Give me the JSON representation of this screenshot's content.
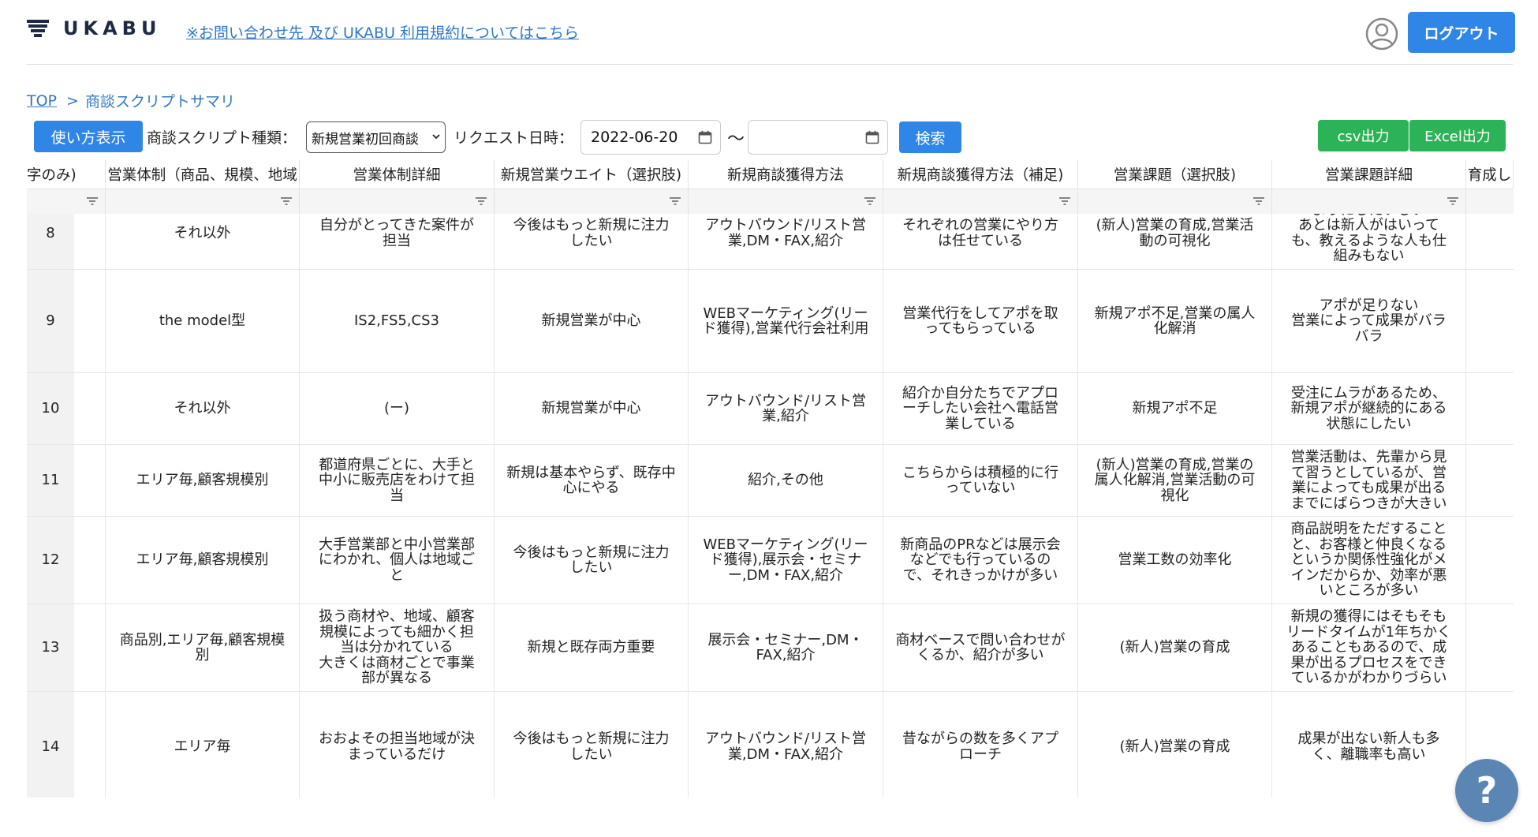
{
  "header": {
    "logo_text": "UKABU",
    "link_text": "※お問い合わせ先 及び UKABU 利用規約についてはこちら",
    "logout_label": "ログアウト"
  },
  "breadcrumb": {
    "top": "TOP",
    "separator": ">",
    "current": "商談スクリプトサマリ"
  },
  "toolbar": {
    "usage_button": "使い方表示",
    "script_type_label": "商談スクリプト種類：",
    "script_type_value": "新規営業初回商談",
    "request_date_label": "リクエスト日時：",
    "date_from": "2022-06-20",
    "date_to": "",
    "tilde": "〜",
    "search_button": "検索",
    "csv_button": "csv出力",
    "excel_button": "Excel出力"
  },
  "columns": [
    "字のみ)",
    "営業体制（商品、規模、地域",
    "営業体制詳細",
    "新規営業ウエイト（選択肢)",
    "新規商談獲得方法",
    "新規商談獲得方法（補足)",
    "営業課題（選択肢)",
    "営業課題詳細",
    "育成し"
  ],
  "rows": [
    {
      "id": "8",
      "c1": [
        "それ以外"
      ],
      "c2": [
        "自分がとってきた案件が",
        "担当"
      ],
      "c3": [
        "今後はもっと新規に注力",
        "したい"
      ],
      "c4": [
        "アウトバウンド/リスト営",
        "業,DM・FAX,紹介"
      ],
      "c5": [
        "それぞれの営業にやり方",
        "は任せている"
      ],
      "c6": [
        "(新人)営業の育成,営業活",
        "動の可視化"
      ],
      "c7": [
        "ようにしたいしい",
        "あとは新人がはいって",
        "も、教えるような人も仕",
        "組みもない"
      ]
    },
    {
      "id": "9",
      "c1": [
        "the model型"
      ],
      "c2": [
        "IS2,FS5,CS3"
      ],
      "c3": [
        "新規営業が中心"
      ],
      "c4": [
        "WEBマーケティング(リー",
        "ド獲得),営業代行会社利用"
      ],
      "c5": [
        "営業代行をしてアポを取",
        "ってもらっている"
      ],
      "c6": [
        "新規アポ不足,営業の属人",
        "化解消"
      ],
      "c7": [
        "アポが足りない",
        "営業によって成果がバラ",
        "バラ"
      ]
    },
    {
      "id": "10",
      "c1": [
        "それ以外"
      ],
      "c2": [
        "(ー)"
      ],
      "c3": [
        "新規営業が中心"
      ],
      "c4": [
        "アウトバウンド/リスト営",
        "業,紹介"
      ],
      "c5": [
        "紹介か自分たちでアプロ",
        "ーチしたい会社へ電話営",
        "業している"
      ],
      "c6": [
        "新規アポ不足"
      ],
      "c7": [
        "受注にムラがあるため、",
        "新規アポが継続的にある",
        "状態にしたい"
      ]
    },
    {
      "id": "11",
      "c1": [
        "エリア毎,顧客規模別"
      ],
      "c2": [
        "都道府県ごとに、大手と",
        "中小に販売店をわけて担",
        "当"
      ],
      "c3": [
        "新規は基本やらず、既存中",
        "心にやる"
      ],
      "c4": [
        "紹介,その他"
      ],
      "c5": [
        "こちらからは積極的に行",
        "っていない"
      ],
      "c6": [
        "(新人)営業の育成,営業の",
        "属人化解消,営業活動の可",
        "視化"
      ],
      "c7": [
        "営業活動は、先輩から見",
        "て習うとしているが、営",
        "業によっても成果が出る",
        "までにばらつきが大きい"
      ]
    },
    {
      "id": "12",
      "c1": [
        "エリア毎,顧客規模別"
      ],
      "c2": [
        "大手営業部と中小営業部",
        "にわかれ、個人は地域ご",
        "と"
      ],
      "c3": [
        "今後はもっと新規に注力",
        "したい"
      ],
      "c4": [
        "WEBマーケティング(リー",
        "ド獲得),展示会・セミナ",
        "ー,DM・FAX,紹介"
      ],
      "c5": [
        "新商品のPRなどは展示会",
        "などでも行っているの",
        "で、それきっかけが多い"
      ],
      "c6": [
        "営業工数の効率化"
      ],
      "c7": [
        "商品説明をただすること",
        "と、お客様と仲良くなる",
        "というか関係性強化がメ",
        "インだからか、効率が悪",
        "いところが多い"
      ]
    },
    {
      "id": "13",
      "c1": [
        "商品別,エリア毎,顧客規模",
        "別"
      ],
      "c2": [
        "扱う商材や、地域、顧客",
        "規模によっても細かく担",
        "当は分かれている",
        "大きくは商材ごとで事業",
        "部が異なる"
      ],
      "c3": [
        "新規と既存両方重要"
      ],
      "c4": [
        "展示会・セミナー,DM・",
        "FAX,紹介"
      ],
      "c5": [
        "商材ベースで問い合わせが",
        "くるか、紹介が多い"
      ],
      "c6": [
        "(新人)営業の育成"
      ],
      "c7": [
        "新規の獲得にはそもそも",
        "リードタイムが1年ちかく",
        "あることもあるので、成",
        "果が出るプロセスをでき",
        "ているかがわかりづらい"
      ]
    },
    {
      "id": "14",
      "c1": [
        "エリア毎"
      ],
      "c2": [
        "おおよその担当地域が決",
        "まっているだけ"
      ],
      "c3": [
        "今後はもっと新規に注力",
        "したい"
      ],
      "c4": [
        "アウトバウンド/リスト営",
        "業,DM・FAX,紹介"
      ],
      "c5": [
        "昔ながらの数を多くアプ",
        "ローチ"
      ],
      "c6": [
        "(新人)営業の育成"
      ],
      "c7": [
        "成果が出ない新人も多",
        "く、離職率も高い"
      ]
    }
  ],
  "help_label": "?"
}
